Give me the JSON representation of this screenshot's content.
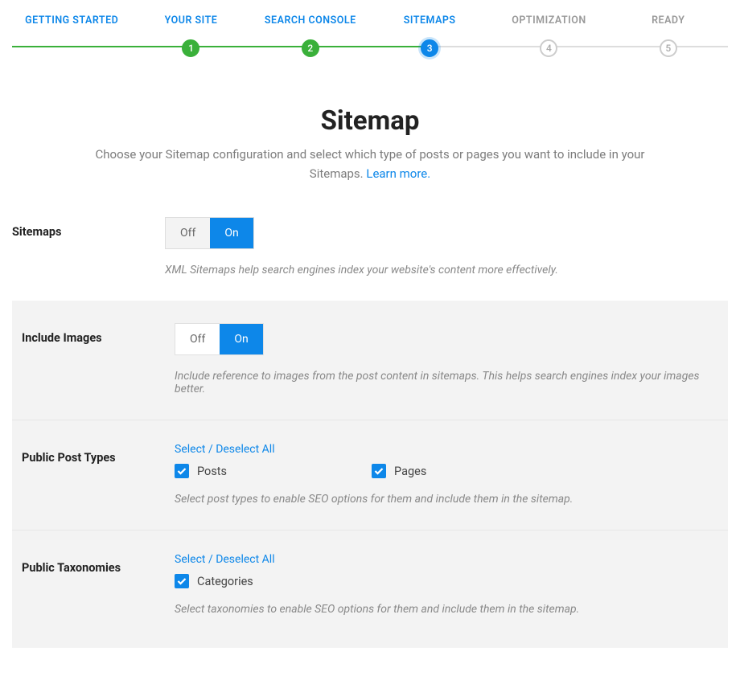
{
  "stepper": {
    "steps": [
      {
        "label": "GETTING STARTED",
        "num": ""
      },
      {
        "label": "YOUR SITE",
        "num": "1"
      },
      {
        "label": "SEARCH CONSOLE",
        "num": "2"
      },
      {
        "label": "SITEMAPS",
        "num": "3"
      },
      {
        "label": "OPTIMIZATION",
        "num": "4"
      },
      {
        "label": "READY",
        "num": "5"
      }
    ]
  },
  "header": {
    "title": "Sitemap",
    "desc_prefix": "Choose your Sitemap configuration and select which type of posts or pages you want to include in your Sitemaps. ",
    "learn_more": "Learn more."
  },
  "sitemaps": {
    "label": "Sitemaps",
    "off": "Off",
    "on": "On",
    "note": "XML Sitemaps help search engines index your website's content more effectively."
  },
  "include_images": {
    "label": "Include Images",
    "off": "Off",
    "on": "On",
    "note": "Include reference to images from the post content in sitemaps. This helps search engines index your images better."
  },
  "post_types": {
    "label": "Public Post Types",
    "select_all": "Select / Deselect All",
    "items": [
      {
        "label": "Posts"
      },
      {
        "label": "Pages"
      }
    ],
    "note": "Select post types to enable SEO options for them and include them in the sitemap."
  },
  "taxonomies": {
    "label": "Public Taxonomies",
    "select_all": "Select / Deselect All",
    "items": [
      {
        "label": "Categories"
      }
    ],
    "note": "Select taxonomies to enable SEO options for them and include them in the sitemap."
  }
}
